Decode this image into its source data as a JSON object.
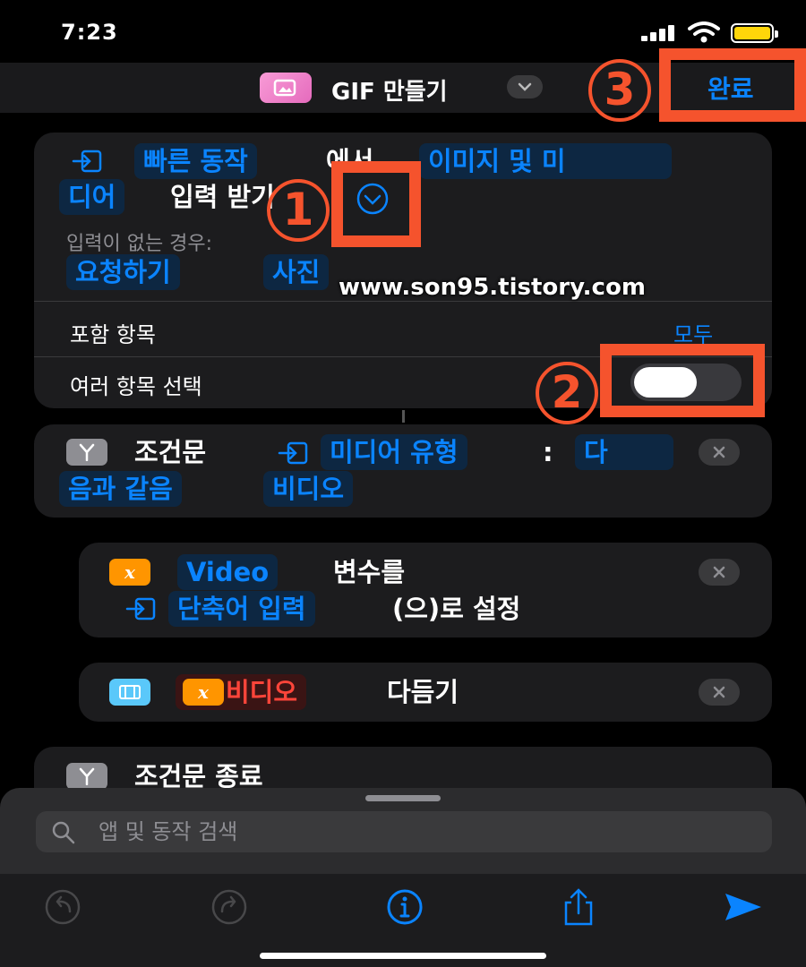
{
  "status": {
    "time": "7:23"
  },
  "nav": {
    "title": "GIF 만들기",
    "done_label": "완료"
  },
  "annotations": {
    "badge1": "1",
    "badge2": "2",
    "badge3": "3",
    "watermark": "www.son95.tistory.com"
  },
  "receive_card": {
    "source_token": "빠른 동작",
    "from_text": "에서",
    "type_token_line1": "이미지 및 미",
    "type_token_line2": "디어",
    "receive_text": "입력 받기",
    "no_input_label": "입력이 없는 경우:",
    "ask_token": "요청하기",
    "photo_token": "사진",
    "include_label": "포함 항목",
    "include_value": "모두",
    "multi_select_label": "여러 항목 선택",
    "multi_select_on": false
  },
  "if_card": {
    "label": "조건문",
    "media_type_token": "미디어 유형",
    "colon": ":",
    "condition_token_line1": "다",
    "condition_token_line2": "음과 같음",
    "value_token": "비디오"
  },
  "set_var_card": {
    "var_icon": "x",
    "var_token": "Video",
    "text1": "변수를",
    "input_token": "단축어 입력",
    "text2": "(으)로 설정"
  },
  "trim_card": {
    "var_icon": "x",
    "var_token": "비디오",
    "text": "다듬기"
  },
  "end_if_card": {
    "label": "조건문 종료"
  },
  "search": {
    "placeholder": "앱 및 동작 검색"
  },
  "colors": {
    "accent": "#0a84ff",
    "annotation": "#f5532d",
    "battery": "#ffd60a",
    "variable": "#ff9500"
  },
  "icons": [
    "input-icon",
    "chevron-down-icon",
    "if-icon",
    "variable-icon",
    "trim-video-icon",
    "close-icon",
    "search-icon",
    "undo-icon",
    "redo-icon",
    "info-icon",
    "share-icon",
    "play-icon"
  ]
}
